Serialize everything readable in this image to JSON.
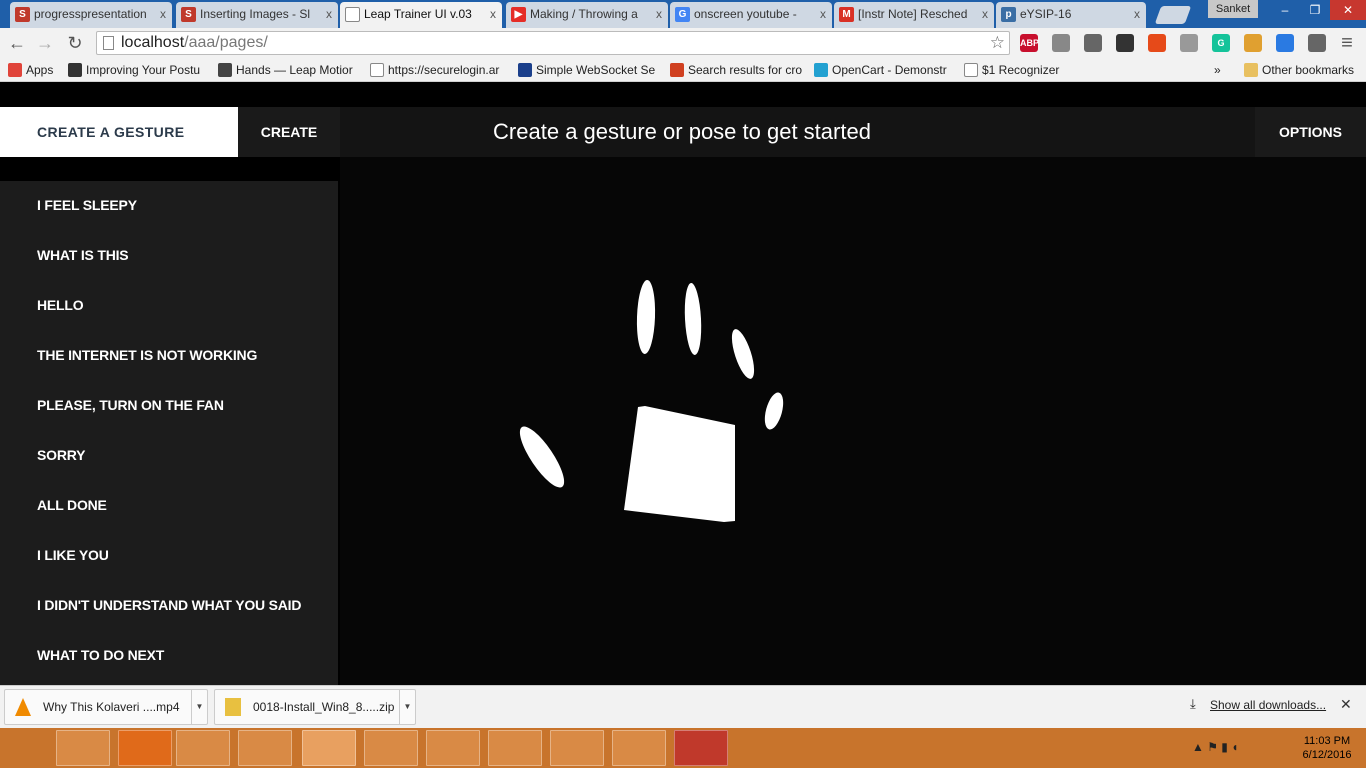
{
  "browser": {
    "tabs": [
      {
        "title": "progresspresentation",
        "favicon": "S",
        "color": "#c0392b",
        "active": false
      },
      {
        "title": "Inserting Images - Sl",
        "favicon": "S",
        "color": "#c0392b",
        "active": false
      },
      {
        "title": "Leap Trainer UI v.03",
        "favicon": "page",
        "color": "#ffffff",
        "active": true
      },
      {
        "title": "Making / Throwing a",
        "favicon": "youtube",
        "color": "#e52d27",
        "active": false
      },
      {
        "title": "onscreen youtube -",
        "favicon": "G",
        "color": "#4285f4",
        "active": false
      },
      {
        "title": "[Instr Note] Resched",
        "favicon": "M",
        "color": "#d93025",
        "active": false
      },
      {
        "title": "eYSIP-16",
        "favicon": "p",
        "color": "#3a6ea5",
        "active": false
      }
    ],
    "tab_close": "x",
    "user": "Sanket",
    "window_buttons": {
      "minimize": "–",
      "restore": "❐",
      "close": "✕"
    },
    "nav": {
      "back": "←",
      "forward": "→",
      "reload": "↻"
    },
    "url_host": "localhost",
    "url_path": "/aaa/pages/",
    "star_icon": "☆",
    "extensions": [
      {
        "name": "adblock-plus-icon",
        "label": "ABP",
        "color": "#c8102e"
      },
      {
        "name": "search-ext-icon",
        "label": "",
        "color": "#888888"
      },
      {
        "name": "x-ext-icon",
        "label": "",
        "color": "#666666"
      },
      {
        "name": "ghost-ext-icon",
        "label": "",
        "color": "#333333"
      },
      {
        "name": "office-icon",
        "label": "",
        "color": "#e64a19"
      },
      {
        "name": "circle-ext-icon",
        "label": "",
        "color": "#999999"
      },
      {
        "name": "grammarly-icon",
        "label": "G",
        "color": "#15c39a"
      },
      {
        "name": "face-ext-icon",
        "label": "",
        "color": "#e0a030"
      },
      {
        "name": "window-ext-icon",
        "label": "",
        "color": "#2a7ae2"
      },
      {
        "name": "gmail-ext-icon",
        "label": "",
        "color": "#666666"
      }
    ],
    "menu_icon": "≡",
    "bookmarks": [
      {
        "label": "Apps",
        "color": "#e0443a"
      },
      {
        "label": "Improving Your Postu",
        "color": "#333333"
      },
      {
        "label": "Hands — Leap Motior",
        "color": "#444444"
      },
      {
        "label": "https://securelogin.ar",
        "color": "#ffffff"
      },
      {
        "label": "Simple WebSocket Se",
        "color": "#1b3f8b"
      },
      {
        "label": "Search results for cro",
        "color": "#d04020"
      },
      {
        "label": "OpenCart - Demonstr",
        "color": "#23a1d1"
      },
      {
        "label": "$1 Recognizer",
        "color": "#ffffff"
      }
    ],
    "bookmarks_overflow": "»",
    "other_bookmarks": "Other bookmarks"
  },
  "app": {
    "gesture_name": "CREATE A GESTURE",
    "create_label": "CREATE",
    "title": "Create a gesture or pose to get started",
    "options_label": "OPTIONS",
    "gestures": [
      "I FEEL SLEEPY",
      "WHAT IS THIS",
      "HELLO",
      "THE INTERNET IS NOT WORKING",
      "PLEASE, TURN ON THE FAN",
      "SORRY",
      "ALL DONE",
      "I LIKE YOU",
      "I DIDN'T UNDERSTAND WHAT YOU SAID",
      "WHAT TO DO NEXT"
    ],
    "colors": {
      "accent": "#ffffff",
      "panel": "#1c1c1c",
      "topbar": "#141414",
      "canvas": "#060606",
      "text_dark": "#2b3a4a"
    }
  },
  "downloads": {
    "items": [
      {
        "name": "Why This Kolaveri ....mp4",
        "icon": "vlc-icon"
      },
      {
        "name": "0018-Install_Win8_8.....zip",
        "icon": "zip-icon"
      }
    ],
    "show_all": "Show all downloads...",
    "close": "✕"
  },
  "taskbar": {
    "icons": [
      {
        "name": "start-button",
        "color": "#c8742c"
      },
      {
        "name": "task-manager-icon",
        "color": "#d98a45"
      },
      {
        "name": "xampp-icon",
        "color": "#e06a1a"
      },
      {
        "name": "file-explorer-icon",
        "color": "#d98a45"
      },
      {
        "name": "notepad-plus-icon",
        "color": "#d98a45"
      },
      {
        "name": "chrome-icon",
        "color": "#e8a060"
      },
      {
        "name": "firefox-icon",
        "color": "#d98a45"
      },
      {
        "name": "media-player-icon",
        "color": "#d98a45"
      },
      {
        "name": "sticky-notes-icon",
        "color": "#d98a45"
      },
      {
        "name": "calculator-icon",
        "color": "#d98a45"
      },
      {
        "name": "sublime-text-icon",
        "color": "#d98a45"
      },
      {
        "name": "music-app-icon",
        "color": "#c0392b"
      }
    ],
    "time": "11:03 PM",
    "date": "6/12/2016"
  }
}
